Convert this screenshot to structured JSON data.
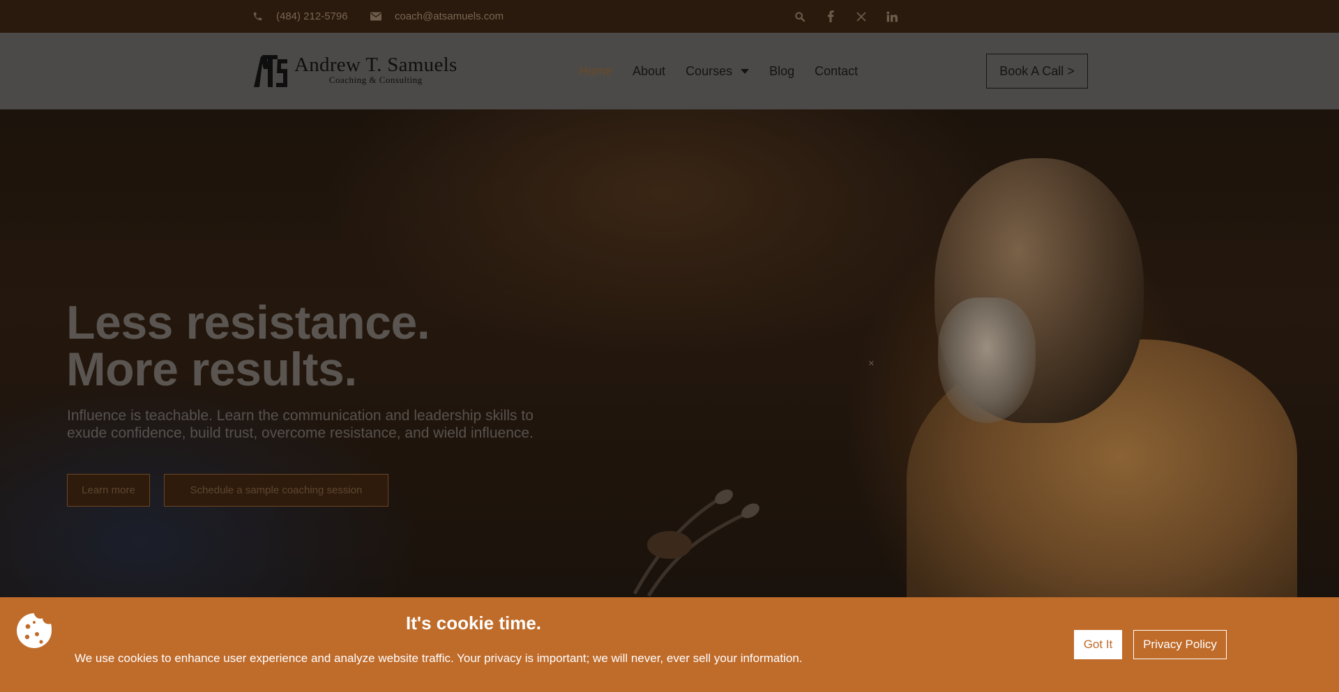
{
  "topbar": {
    "phone": "(484) 212-5796",
    "email": "coach@atsamuels.com",
    "icons": [
      "phone-icon",
      "mail-icon",
      "search-icon",
      "facebook-icon",
      "x-icon",
      "linkedin-icon"
    ]
  },
  "header": {
    "logo_name": "Andrew T. Samuels",
    "logo_sub": "Coaching & Consulting",
    "nav": [
      "Home",
      "About",
      "Courses",
      "Blog",
      "Contact"
    ],
    "book_label": "Book A Call >"
  },
  "hero": {
    "title_line1": "Less resistance.",
    "title_line2": "More results.",
    "subtitle_line1": "Influence is teachable. Learn the communication and leadership skills to",
    "subtitle_line2": "exude confidence, build trust, overcome resistance, and wield influence.",
    "learn_label": "Learn more",
    "schedule_label": "Schedule a sample coaching session",
    "close_glyph": "×"
  },
  "cookie": {
    "title": "It's cookie time.",
    "text": "We use cookies to enhance user experience and analyze website traffic. Your privacy is important; we will never, ever sell your information.",
    "got_label": "Got It",
    "policy_label": "Privacy Policy"
  },
  "colors": {
    "topbar_bg": "#2a1a0d",
    "accent": "#bf6b2a",
    "active_nav": "#6a4a27"
  }
}
